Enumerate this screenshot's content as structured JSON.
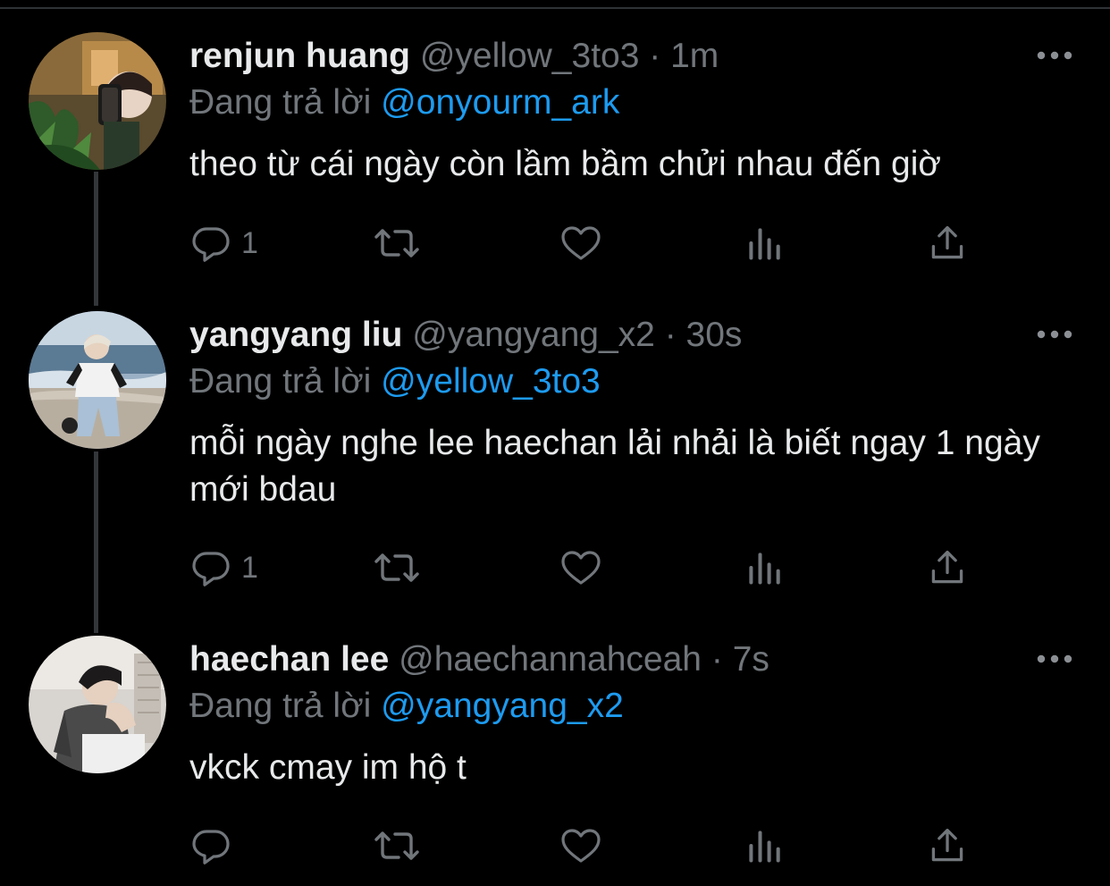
{
  "thread": {
    "reply_prefix": "Đang trả lời",
    "tweets": [
      {
        "display_name": "renjun huang",
        "handle": "@yellow_3to3",
        "separator": "·",
        "time": "1m",
        "reply_to": "@onyourm_ark",
        "text": "theo từ cái ngày còn lầm bầm chửi nhau đến giờ",
        "reply_count": "1",
        "avatar_icon": "avatar-photo-selfie"
      },
      {
        "display_name": "yangyang liu",
        "handle": "@yangyang_x2",
        "separator": "·",
        "time": "30s",
        "reply_to": "@yellow_3to3",
        "text": "mỗi ngày nghe lee haechan lải nhải là biết ngay 1 ngày mới bdau",
        "reply_count": "1",
        "avatar_icon": "avatar-photo-beach"
      },
      {
        "display_name": "haechan lee",
        "handle": "@haechannahceah",
        "separator": "·",
        "time": "7s",
        "reply_to": "@yangyang_x2",
        "text": "vkck cmay im hộ t",
        "reply_count": "",
        "avatar_icon": "avatar-photo-indoor"
      }
    ]
  },
  "icons": {
    "more": "more-horizontal-icon",
    "reply": "reply-bubble-icon",
    "retweet": "retweet-icon",
    "like": "heart-icon",
    "views": "analytics-bars-icon",
    "share": "share-upload-icon"
  },
  "colors": {
    "background": "#000000",
    "primary_text": "#e7e9ea",
    "secondary_text": "#71767b",
    "mention": "#1d9bf0",
    "thread_line": "#333639"
  }
}
